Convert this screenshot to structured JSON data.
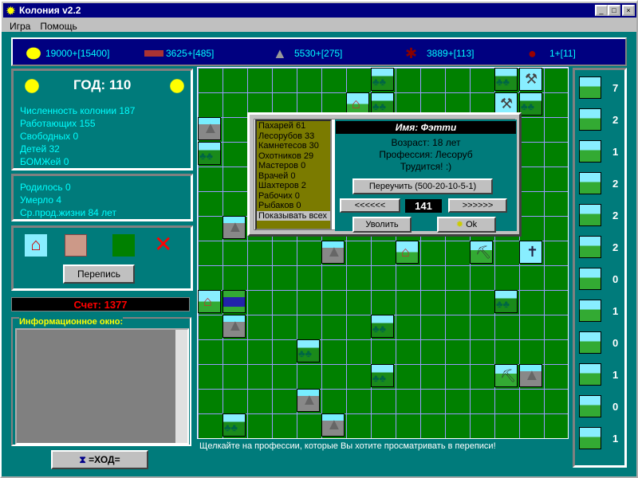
{
  "window": {
    "title": "Колония v2.2",
    "menu": [
      "Игра",
      "Помощь"
    ]
  },
  "resources": [
    {
      "icon": "food-icon",
      "value": "19000+[15400]"
    },
    {
      "icon": "wood-icon",
      "value": "3625+[485]"
    },
    {
      "icon": "stone-icon",
      "value": "5530+[275]"
    },
    {
      "icon": "leather-icon",
      "value": "3889+[113]"
    },
    {
      "icon": "ore-icon",
      "value": "1+[11]"
    }
  ],
  "stats": {
    "year": "ГОД: 110",
    "lines": [
      "Численность колонии   187",
      "Работающих   155",
      "Свободных   0",
      "Детей   32",
      "БОМЖей   0"
    ],
    "lines2": [
      "Родилось   0",
      "Умерло   4",
      "Ср.прод.жизни   84 лет"
    ]
  },
  "census_button": "Перепись",
  "score": "Счет: 1377",
  "info_window_title": "Информационное окно:",
  "turn_button": "=ХОД=",
  "status": "Щелкайте на профессии, которые Вы хотите просматривать в переписи!",
  "dialog": {
    "professions": [
      "Пахарей 61",
      "Лесорубов 33",
      "Камнетесов 30",
      "Охотников 29",
      "Мастеров 0",
      "Врачей 0",
      "Шахтеров 2",
      "Рабочих 0",
      "Рыбаков 0",
      "Показывать всех"
    ],
    "name": "Имя:  Фэтти",
    "age": "Возраст: 18 лет",
    "profession": "Профессия: Лесоруб",
    "state": "Трудится! :)",
    "retrain": "Переучить (500-20-10-5-1)",
    "prev": "<<<<<<",
    "index": "141",
    "next": ">>>>>>",
    "fire": "Уволить",
    "ok": "Ok"
  },
  "building_counts": [
    "7",
    "2",
    "1",
    "2",
    "2",
    "2",
    "0",
    "1",
    "0",
    "1",
    "0",
    "1"
  ],
  "map_tiles": [
    [
      "forest",
      7,
      0
    ],
    [
      "forest",
      12,
      0
    ],
    [
      "sawmill",
      13,
      0
    ],
    [
      "house",
      6,
      1
    ],
    [
      "forest",
      7,
      1
    ],
    [
      "sawmill",
      12,
      1
    ],
    [
      "forest",
      13,
      1
    ],
    [
      "mountain",
      0,
      2
    ],
    [
      "forest",
      0,
      3
    ],
    [
      "mountain",
      1,
      6
    ],
    [
      "mountain",
      5,
      7
    ],
    [
      "house",
      8,
      7
    ],
    [
      "mine",
      11,
      7
    ],
    [
      "church",
      13,
      7
    ],
    [
      "house",
      0,
      9
    ],
    [
      "lake",
      1,
      9
    ],
    [
      "forest",
      12,
      9
    ],
    [
      "mountain",
      1,
      10
    ],
    [
      "forest",
      7,
      10
    ],
    [
      "forest",
      4,
      11
    ],
    [
      "forest",
      7,
      12
    ],
    [
      "mine",
      12,
      12
    ],
    [
      "mountain",
      13,
      12
    ],
    [
      "mountain",
      4,
      13
    ],
    [
      "forest",
      1,
      14
    ],
    [
      "mountain",
      5,
      14
    ]
  ],
  "colors": {
    "panel": "#007b7b",
    "map": "#008000",
    "resbar": "#000080"
  }
}
